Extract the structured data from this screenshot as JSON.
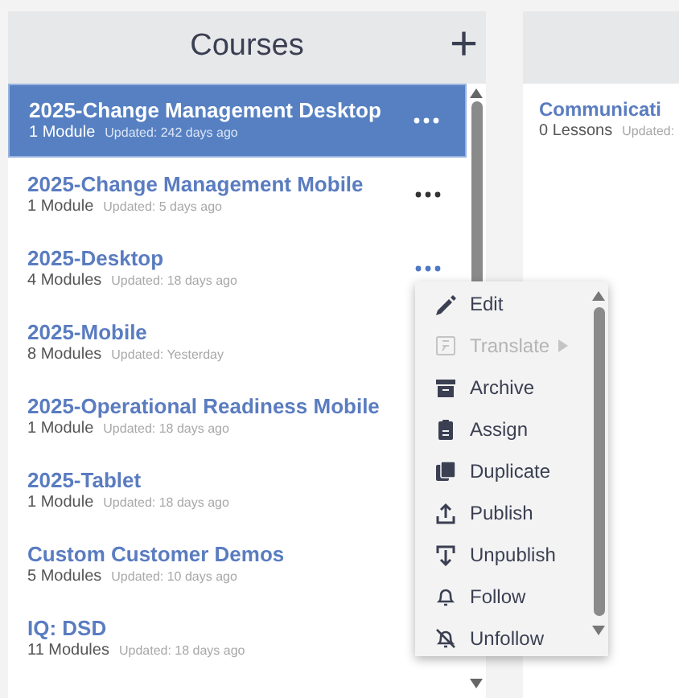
{
  "courses_panel": {
    "title": "Courses",
    "add_button": "+",
    "items": [
      {
        "title": "2025-Change Management Desktop",
        "count": "1 Module",
        "updated": "Updated: 242 days ago",
        "selected": true,
        "actions_visible": true,
        "menu_open": false
      },
      {
        "title": "2025-Change Management Mobile",
        "count": "1 Module",
        "updated": "Updated: 5 days ago",
        "selected": false,
        "actions_visible": true,
        "menu_open": false
      },
      {
        "title": "2025-Desktop",
        "count": "4 Modules",
        "updated": "Updated: 18 days ago",
        "selected": false,
        "actions_visible": true,
        "menu_open": true
      },
      {
        "title": "2025-Mobile",
        "count": "8 Modules",
        "updated": "Updated: Yesterday",
        "selected": false,
        "actions_visible": false
      },
      {
        "title": "2025-Operational Readiness Mobile",
        "count": "1 Module",
        "updated": "Updated: 18 days ago",
        "selected": false,
        "actions_visible": false
      },
      {
        "title": "2025-Tablet",
        "count": "1 Module",
        "updated": "Updated: 18 days ago",
        "selected": false,
        "actions_visible": false
      },
      {
        "title": "Custom Customer Demos",
        "count": "5 Modules",
        "updated": "Updated: 10 days ago",
        "selected": false,
        "actions_visible": false
      },
      {
        "title": "IQ: DSD",
        "count": "11 Modules",
        "updated": "Updated: 18 days ago",
        "selected": false,
        "actions_visible": false
      }
    ]
  },
  "context_menu": {
    "items": [
      {
        "label": "Edit",
        "disabled": false
      },
      {
        "label": "Translate",
        "disabled": true,
        "submenu": true
      },
      {
        "label": "Archive",
        "disabled": false
      },
      {
        "label": "Assign",
        "disabled": false
      },
      {
        "label": "Duplicate",
        "disabled": false
      },
      {
        "label": "Publish",
        "disabled": false
      },
      {
        "label": "Unpublish",
        "disabled": false
      },
      {
        "label": "Follow",
        "disabled": false
      },
      {
        "label": "Unfollow",
        "disabled": false
      }
    ]
  },
  "modules_panel": {
    "items": [
      {
        "title": "Communicati",
        "count": "0 Lessons",
        "updated": "Updated:"
      }
    ]
  }
}
